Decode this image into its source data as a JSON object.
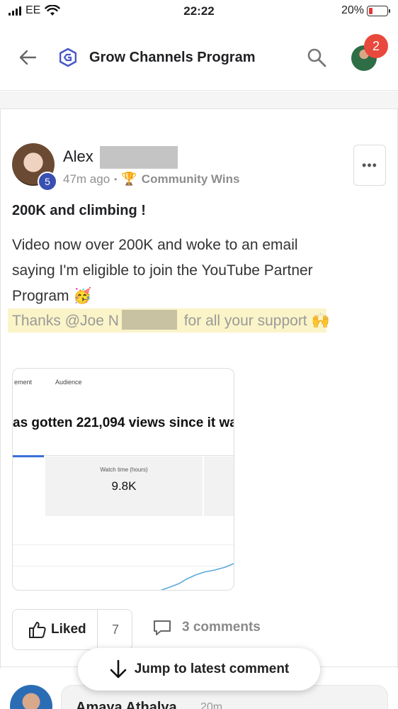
{
  "status_bar": {
    "carrier": "EE",
    "time": "22:22",
    "battery_percent_text": "20%",
    "battery_level": 0.2
  },
  "header": {
    "title": "Grow Channels Program",
    "notification_count": "2",
    "back_icon": "arrow-left-icon",
    "search_icon": "search-icon"
  },
  "post": {
    "author_first_name": "Alex",
    "level": "5",
    "time_ago": "47m ago",
    "separator": "•",
    "category_icon": "🏆",
    "category": "Community Wins",
    "more_label": "•••",
    "title": "200K and climbing !",
    "body_lines": [
      "Video now over 200K and woke to an email",
      "saying I'm eligible to join the YouTube Partner",
      "Program 🥳"
    ],
    "thanks_prefix": "Thanks ",
    "mention": "@Joe N",
    "thanks_suffix": " for all your support 🙌",
    "attachment": {
      "tab1": "ement",
      "tab2": "Audience",
      "headline": "as gotten 221,094 views since it wa",
      "metric_label": "Watch time (hours)",
      "metric_value": "9.8K"
    },
    "liked_label": "Liked",
    "like_count": "7",
    "comments_label": "3 comments"
  },
  "comment_preview": {
    "name": "Amaya Athalya",
    "time": "20m"
  },
  "jump_button": {
    "label": "Jump to latest comment"
  },
  "colors": {
    "badge_red": "#e8493c",
    "level_blue": "#3a4fb2",
    "highlight_yellow": "#fbf4c8",
    "chart_line": "#5aaad8"
  }
}
